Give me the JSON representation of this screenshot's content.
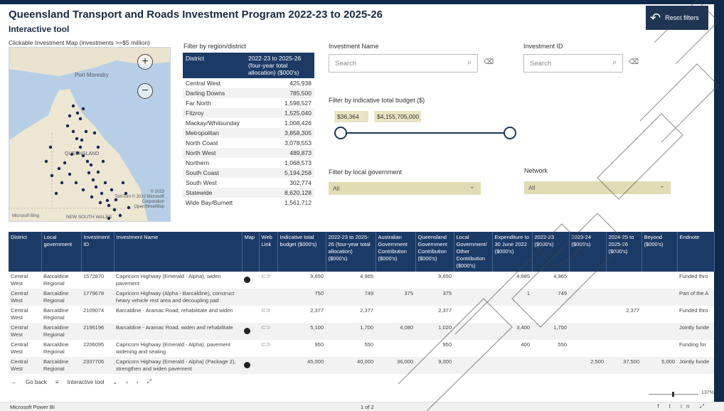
{
  "header": {
    "title": "Queensland Transport and Roads Investment Program 2022-23 to 2025-26",
    "subtitle": "Interactive tool",
    "map_caption": "Clickable Investment Map (investments >=$5 million)",
    "reset_label": "Reset filters"
  },
  "map": {
    "labels": [
      "Port Moresby",
      "QUEENSLAND",
      "NEW SOUTH WALES"
    ],
    "attribution": [
      "© 2023",
      "TomTom © 2022 Microsoft",
      "Corporation",
      "OpenStreetMap"
    ],
    "brand": "Microsoft Bing",
    "zoom_in": "+",
    "zoom_out": "−"
  },
  "district_filter": {
    "label": "Filter by region/district",
    "col_district": "District",
    "col_value": "2022-23 to 2025-26 (four-year total allocation) ($000's)",
    "rows": [
      {
        "name": "Central West",
        "value": "425,938"
      },
      {
        "name": "Darling Downs",
        "value": "785,500"
      },
      {
        "name": "Far North",
        "value": "1,598,527"
      },
      {
        "name": "Fitzroy",
        "value": "1,525,040"
      },
      {
        "name": "Mackay/Whitsunday",
        "value": "1,008,426"
      },
      {
        "name": "Metropolitan",
        "value": "3,858,305"
      },
      {
        "name": "North Coast",
        "value": "3,078,553"
      },
      {
        "name": "North West",
        "value": "489,873"
      },
      {
        "name": "Northern",
        "value": "1,068,573"
      },
      {
        "name": "South Coast",
        "value": "5,194,258"
      },
      {
        "name": "South West",
        "value": "302,774"
      },
      {
        "name": "Statewide",
        "value": "8,620,128"
      },
      {
        "name": "Wide Bay/Burnett",
        "value": "1,561,712"
      }
    ]
  },
  "filters": {
    "investment_name_label": "Investment Name",
    "investment_name_placeholder": "Search",
    "investment_id_label": "Investment ID",
    "investment_id_placeholder": "Search",
    "budget_label": "Filter by indicative total budget ($)",
    "budget_min": "$36,364",
    "budget_max": "$4,155,705,000",
    "local_gov_label": "Filter by local government",
    "local_gov_value": "All",
    "network_label": "Network",
    "network_value": "All"
  },
  "table": {
    "headers": [
      "District",
      "Local government",
      "Investment ID",
      "Investment Name",
      "Map",
      "Web Link",
      "Indicative total budget ($000's)",
      "2022-23 to 2025-26 (four-year total allocation) ($000's)",
      "Australian Government Contribution ($000's)",
      "Queensland Government Contribution ($000's)",
      "Local Government/ Other Contribution ($000's)",
      "Expenditure to 30 June 2022 ($000's)",
      "2022-23 ($000's)",
      "2023-24 ($000's)",
      "2024-25 to 2025-26 ($000's)",
      "Beyond ($000's)",
      "Endnote"
    ],
    "rows": [
      {
        "district": "Central West",
        "lg": "Barcaldine Regional",
        "id": "1572870",
        "name": "Capricorn Highway (Emerald - Alpha), widen pavement",
        "map": true,
        "link": true,
        "budget": "9,650",
        "alloc": "4,965",
        "aus": "",
        "qld": "9,650",
        "local": "",
        "exp": "4,685",
        "y22": "4,965",
        "y23": "",
        "y24": "",
        "beyond": "",
        "note": "Funded thro"
      },
      {
        "district": "Central West",
        "lg": "Barcaldine Regional",
        "id": "1779678",
        "name": "Capricorn Highway (Alpha - Barcaldine), construct heavy vehicle rest area and decoupling pad",
        "map": false,
        "link": false,
        "budget": "750",
        "alloc": "749",
        "aus": "375",
        "qld": "375",
        "local": "",
        "exp": "1",
        "y22": "749",
        "y23": "",
        "y24": "",
        "beyond": "",
        "note": "Part of the A"
      },
      {
        "district": "Central West",
        "lg": "Barcaldine Regional",
        "id": "2109074",
        "name": "Barcaldine - Aramac Road, rehabilitate and widen",
        "map": false,
        "link": true,
        "budget": "2,377",
        "alloc": "2,377",
        "aus": "",
        "qld": "2,377",
        "local": "",
        "exp": "",
        "y22": "",
        "y23": "",
        "y24": "2,377",
        "beyond": "",
        "note": "Funded thro"
      },
      {
        "district": "Central West",
        "lg": "Barcaldine Regional",
        "id": "2196196",
        "name": "Barcaldine - Aramac Road, widen and rehabilitate",
        "map": true,
        "link": true,
        "budget": "5,100",
        "alloc": "1,700",
        "aus": "4,080",
        "qld": "1,020",
        "local": "",
        "exp": "3,400",
        "y22": "1,700",
        "y23": "",
        "y24": "",
        "beyond": "",
        "note": "Jointly funde"
      },
      {
        "district": "Central West",
        "lg": "Barcaldine Regional",
        "id": "2206095",
        "name": "Capricorn Highway (Emerald - Alpha), pavement widening and sealing",
        "map": false,
        "link": true,
        "budget": "950",
        "alloc": "550",
        "aus": "",
        "qld": "950",
        "local": "",
        "exp": "400",
        "y22": "550",
        "y23": "",
        "y24": "",
        "beyond": "",
        "note": "Funding for"
      },
      {
        "district": "Central West",
        "lg": "Barcaldine Regional",
        "id": "2337706",
        "name": "Capricorn Highway (Emerald - Alpha) (Package 2), strengthen and widen pavement",
        "map": true,
        "link": false,
        "budget": "45,000",
        "alloc": "40,000",
        "aus": "36,000",
        "qld": "9,000",
        "local": "",
        "exp": "",
        "y22": "",
        "y23": "2,500",
        "y24": "37,500",
        "beyond": "5,000",
        "note": "Jointly funde"
      }
    ]
  },
  "nav": {
    "back": "Go back",
    "page_name": "Interactive tool"
  },
  "status": {
    "app": "Microsoft Power BI",
    "page": "1 of 2",
    "zoom": "137%"
  },
  "colors": {
    "header_navy": "#1b3a66",
    "frame": "#0f2a4a",
    "filter_tan": "#e0ddb4"
  }
}
